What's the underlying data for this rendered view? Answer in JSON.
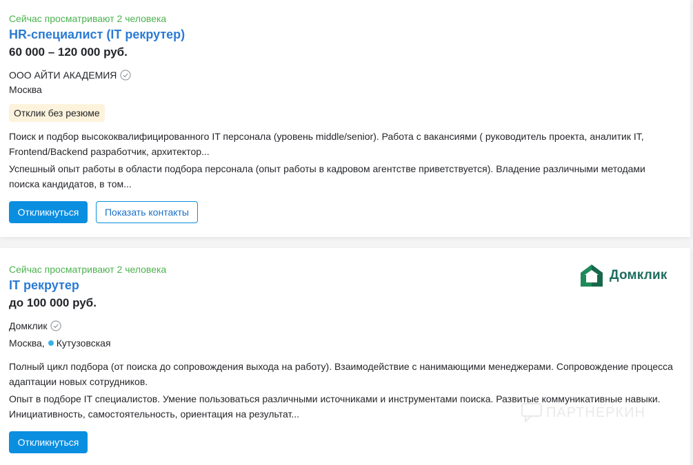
{
  "colors": {
    "viewers": "#4bb24e",
    "title": "#2b7bd3",
    "primary_button": "#0a8ee0",
    "badge_bg": "#fdf3dc",
    "metro_dot": "#37b1e7",
    "logo_green": "#1f6d5f"
  },
  "vacancies": [
    {
      "viewers": "Сейчас просматривают 2 человека",
      "title": "HR-специалист (IT рекрутер)",
      "salary": "60 000 – 120 000 руб.",
      "employer": "ООО АЙТИ АКАДЕМИЯ",
      "employer_icon": "verified-check-icon",
      "city": "Москва",
      "badge": "Отклик без резюме",
      "description_1": "Поиск и подбор высококвалифицированного IT персонала (уровень middle/senior). Работа с вакансиями ( руководитель проекта, аналитик IT, Frontend/Backend разработчик, архитектор...",
      "description_2": "Успешный опыт работы в области подбора персонала (опыт работы в кадровом агентстве приветствуется). Владение различными методами поиска кандидатов, в том...",
      "respond_label": "Откликнуться",
      "contacts_label": "Показать контакты"
    },
    {
      "viewers": "Сейчас просматривают 2 человека",
      "title": "IT рекрутер",
      "salary": "до 100 000 руб.",
      "employer": "Домклик",
      "employer_icon": "verified-check-icon",
      "city": "Москва,",
      "metro": "Кутузовская",
      "logo_text": "Домклик",
      "description_1": "Полный цикл подбора (от поиска до сопровождения выхода на работу). Взаимодействие с нанимающими менеджерами. Сопровождение процесса адаптации новых сотрудников.",
      "description_2": "Опыт в подборе IT специалистов. Умение пользоваться различными источниками и инструментами поиска. Развитые коммуникативные навыки. Инициативность, самостоятельность, ориентация на результат...",
      "respond_label": "Откликнуться",
      "watermark": "ПАРТНЕРКИН"
    }
  ]
}
